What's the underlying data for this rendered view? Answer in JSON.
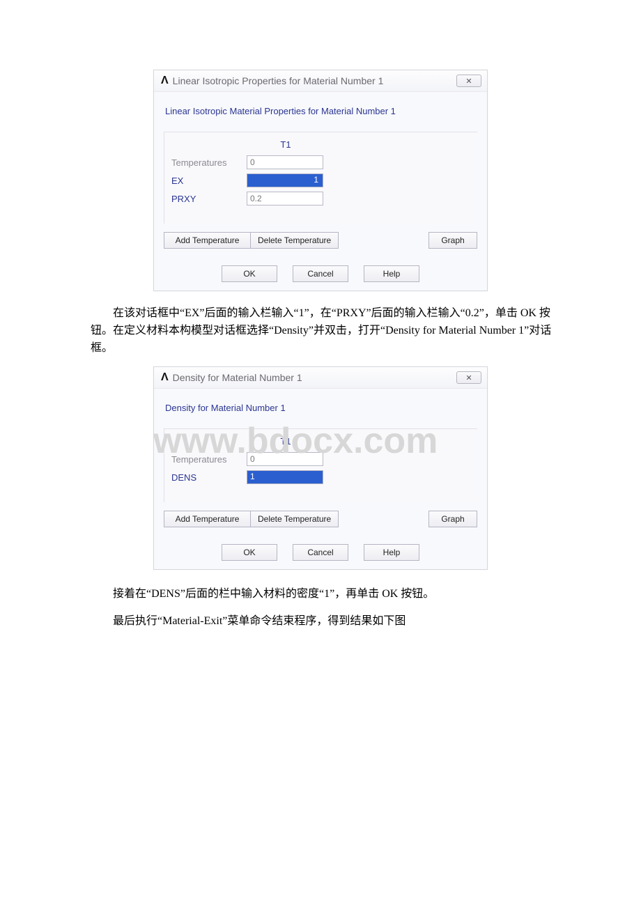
{
  "dialog1": {
    "title": "Linear Isotropic Properties for Material Number 1",
    "close_glyph": "✕",
    "section": "Linear Isotropic Material Properties for Material Number 1",
    "col_header": "T1",
    "rows": {
      "temperatures_label": "Temperatures",
      "temperatures_value": "0",
      "ex_label": "EX",
      "ex_value": "1",
      "prxy_label": "PRXY",
      "prxy_value": "0.2"
    },
    "buttons": {
      "add_temp": "Add Temperature",
      "del_temp": "Delete Temperature",
      "graph": "Graph",
      "ok": "OK",
      "cancel": "Cancel",
      "help": "Help"
    }
  },
  "paragraph1": "在该对话框中“EX”后面的输入栏输入“1”，在“PRXY”后面的输入栏输入“0.2”，单击 OK 按钮。在定义材料本构模型对话框选择“Density”并双击，打开“Density for Material Number 1”对话框。",
  "dialog2": {
    "title": "Density for Material Number 1",
    "close_glyph": "✕",
    "section": "Density for Material Number 1",
    "col_header": "T1",
    "rows": {
      "temperatures_label": "Temperatures",
      "temperatures_value": "0",
      "dens_label": "DENS",
      "dens_value": "1"
    },
    "buttons": {
      "add_temp": "Add Temperature",
      "del_temp": "Delete Temperature",
      "graph": "Graph",
      "ok": "OK",
      "cancel": "Cancel",
      "help": "Help"
    }
  },
  "paragraph2": "接着在“DENS”后面的栏中输入材料的密度“1”，再单击 OK 按钮。",
  "paragraph3": "最后执行“Material-Exit”菜单命令结束程序，得到结果如下图",
  "watermark": "www.bdocx.com"
}
